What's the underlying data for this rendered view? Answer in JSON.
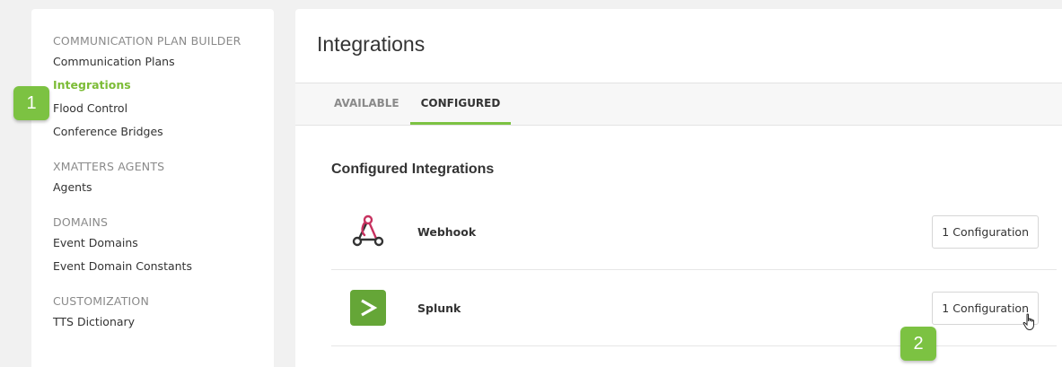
{
  "sidebar": {
    "groups": [
      {
        "heading": "COMMUNICATION PLAN BUILDER",
        "items": [
          "Communication Plans",
          "Integrations",
          "Flood Control",
          "Conference Bridges"
        ]
      },
      {
        "heading": "XMATTERS AGENTS",
        "items": [
          "Agents"
        ]
      },
      {
        "heading": "DOMAINS",
        "items": [
          "Event Domains",
          "Event Domain Constants"
        ]
      },
      {
        "heading": "CUSTOMIZATION",
        "items": [
          "TTS Dictionary"
        ]
      }
    ]
  },
  "badges": {
    "one": "1",
    "two": "2"
  },
  "main": {
    "title": "Integrations",
    "tabs": [
      {
        "label": "AVAILABLE"
      },
      {
        "label": "CONFIGURED"
      }
    ],
    "section_title": "Configured Integrations",
    "integrations": [
      {
        "name": "Webhook",
        "button": "1 Configuration",
        "icon": "webhook-icon"
      },
      {
        "name": "Splunk",
        "button": "1 Configuration",
        "icon": "splunk-icon"
      }
    ]
  },
  "colors": {
    "accent": "#7cc242",
    "active_link": "#7cbc36",
    "webhook_pink": "#c7315f",
    "splunk_green": "#65a637"
  }
}
